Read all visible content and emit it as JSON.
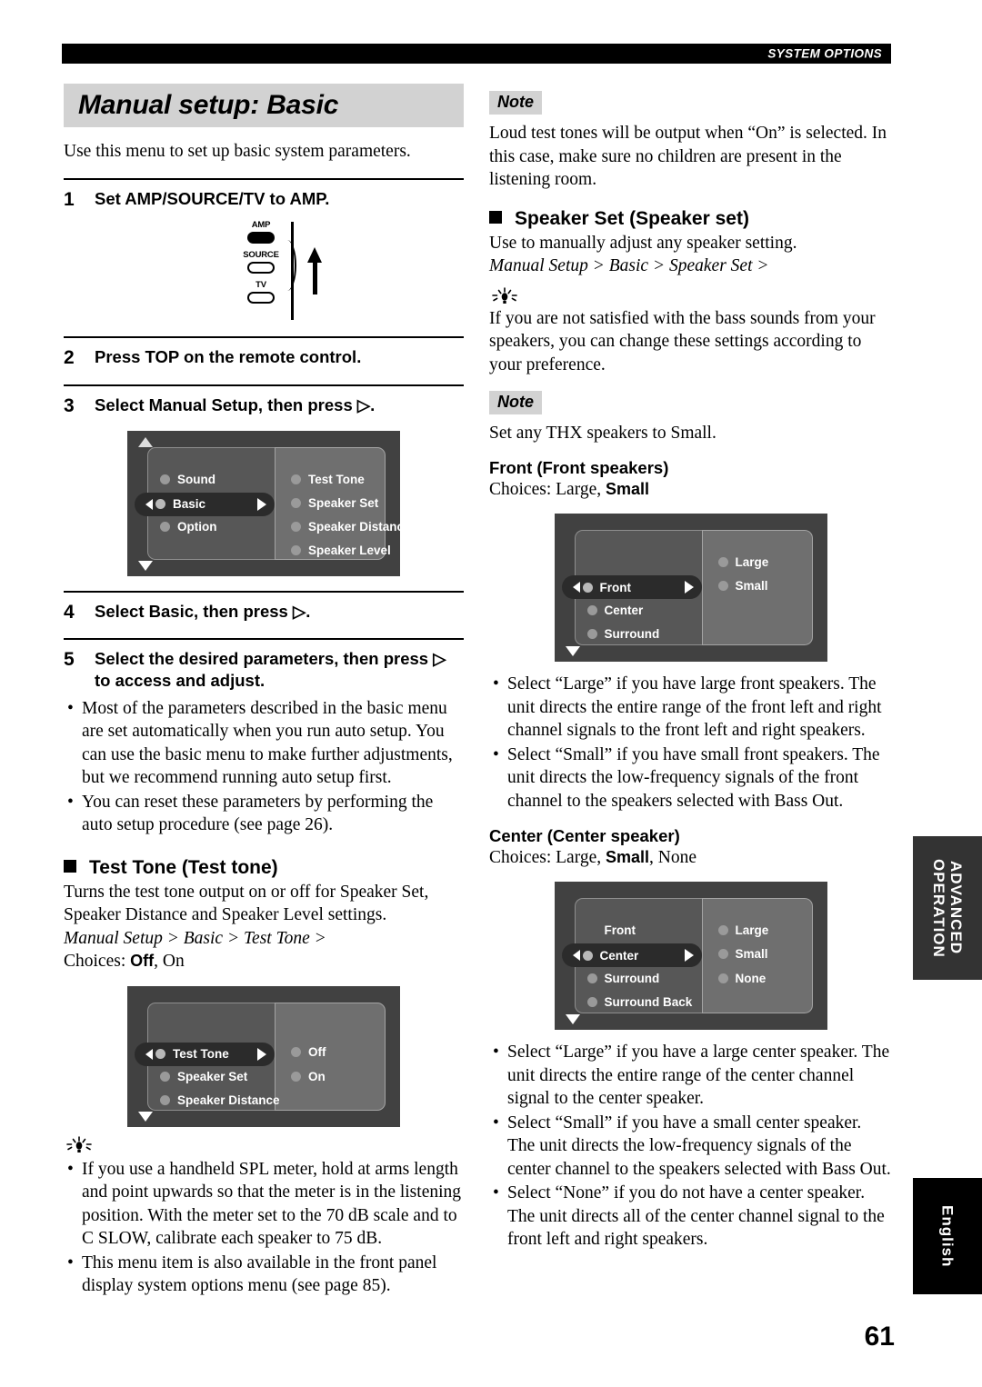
{
  "header": {
    "running_head": "SYSTEM OPTIONS"
  },
  "page_number": "61",
  "left": {
    "title": "Manual setup: Basic",
    "intro": "Use this menu to set up basic system parameters.",
    "steps": [
      {
        "num": "1",
        "text": "Set AMP/SOURCE/TV to AMP."
      },
      {
        "num": "2",
        "text": "Press TOP on the remote control."
      },
      {
        "num": "3",
        "text": "Select Manual Setup, then press ▷."
      },
      {
        "num": "4",
        "text": "Select Basic, then press ▷."
      },
      {
        "num": "5",
        "text": "Select the desired parameters, then press ▷ to access and adjust."
      }
    ],
    "switch_figure": {
      "options": [
        "AMP",
        "SOURCE",
        "TV"
      ],
      "selected": "AMP",
      "arrow": "up-arrow"
    },
    "menu_manual_setup": {
      "left_items": [
        "Sound",
        "Basic",
        "Option"
      ],
      "selected": "Basic",
      "right_items": [
        "Test Tone",
        "Speaker Set",
        "Speaker Distance",
        "Speaker Level"
      ],
      "scroll_up": true,
      "scroll_down": true
    },
    "step5_notes": [
      "Most of the parameters described in the basic menu are set automatically when you run auto setup. You can use the basic menu to make further adjustments, but we recommend running auto setup first.",
      "You can reset these parameters by performing the auto setup procedure (see page 26)."
    ],
    "test_tone": {
      "heading": "Test Tone (Test tone)",
      "body": "Turns the test tone output on or off for Speaker Set, Speaker Distance and Speaker Level settings.",
      "path": "Manual Setup > Basic > Test Tone >",
      "choices_label": "Choices: ",
      "choices_bold": "Off",
      "choices_rest": ", On",
      "menu": {
        "left_items": [
          "Test Tone",
          "Speaker Set",
          "Speaker Distance"
        ],
        "selected": "Test Tone",
        "right_items": [
          "Off",
          "On"
        ],
        "scroll_up": false,
        "scroll_down": true
      }
    },
    "tips": [
      "If you use a handheld SPL meter, hold at arms length and point upwards so that the meter is in the listening position. With the meter set to the 70 dB scale and to C SLOW, calibrate each speaker to 75 dB.",
      "This menu item is also available in the front panel display system options menu (see page 85)."
    ]
  },
  "right": {
    "note1": {
      "tag": "Note",
      "text": "Loud test tones will be output when “On” is selected. In this case, make sure no children are present in the listening room."
    },
    "speaker_set": {
      "heading": "Speaker Set (Speaker set)",
      "body": "Use to manually adjust any speaker setting.",
      "path": "Manual Setup > Basic > Speaker Set >",
      "tip": "If you are not satisfied with the bass sounds from your speakers, you can change these settings according to your preference."
    },
    "note2": {
      "tag": "Note",
      "text": "Set any THX speakers to Small."
    },
    "front": {
      "heading": "Front (Front speakers)",
      "choices_label": "Choices: ",
      "choices_parts": [
        {
          "text": "Large",
          "bold": false
        },
        {
          "text": ", ",
          "bold": false
        },
        {
          "text": "Small",
          "bold": true
        }
      ],
      "menu": {
        "left_items": [
          "Front",
          "Center",
          "Surround"
        ],
        "selected": "Front",
        "right_items": [
          "Large",
          "Small"
        ],
        "scroll_up": false,
        "scroll_down": true
      },
      "bullets": [
        "Select “Large” if you have large front speakers. The unit directs the entire range of the front left and right channel signals to the front left and right speakers.",
        "Select “Small” if you have small front speakers. The unit directs the low-frequency signals of the front channel to the speakers selected with Bass Out."
      ]
    },
    "center": {
      "heading": "Center (Center speaker)",
      "choices_label": "Choices: ",
      "choices_parts": [
        {
          "text": "Large",
          "bold": false
        },
        {
          "text": ", ",
          "bold": false
        },
        {
          "text": "Small",
          "bold": true
        },
        {
          "text": ", None",
          "bold": false
        }
      ],
      "menu": {
        "left_items": [
          "Front",
          "Center",
          "Surround",
          "Surround Back"
        ],
        "selected": "Center",
        "right_items": [
          "Large",
          "Small",
          "None"
        ],
        "scroll_up": false,
        "scroll_down": true
      },
      "bullets": [
        "Select “Large” if you have a large center speaker. The unit directs the entire range of the center channel signal to the center speaker.",
        "Select “Small” if you have a small center speaker. The unit directs the low-frequency signals of the center channel to the speakers selected with Bass Out.",
        "Select “None” if you do not have a center speaker. The unit directs all of the center channel signal to the front left and right speakers."
      ]
    }
  },
  "side_tabs": [
    {
      "line1": "ADVANCED",
      "line2": "OPERATION"
    },
    {
      "line1": "English"
    }
  ]
}
